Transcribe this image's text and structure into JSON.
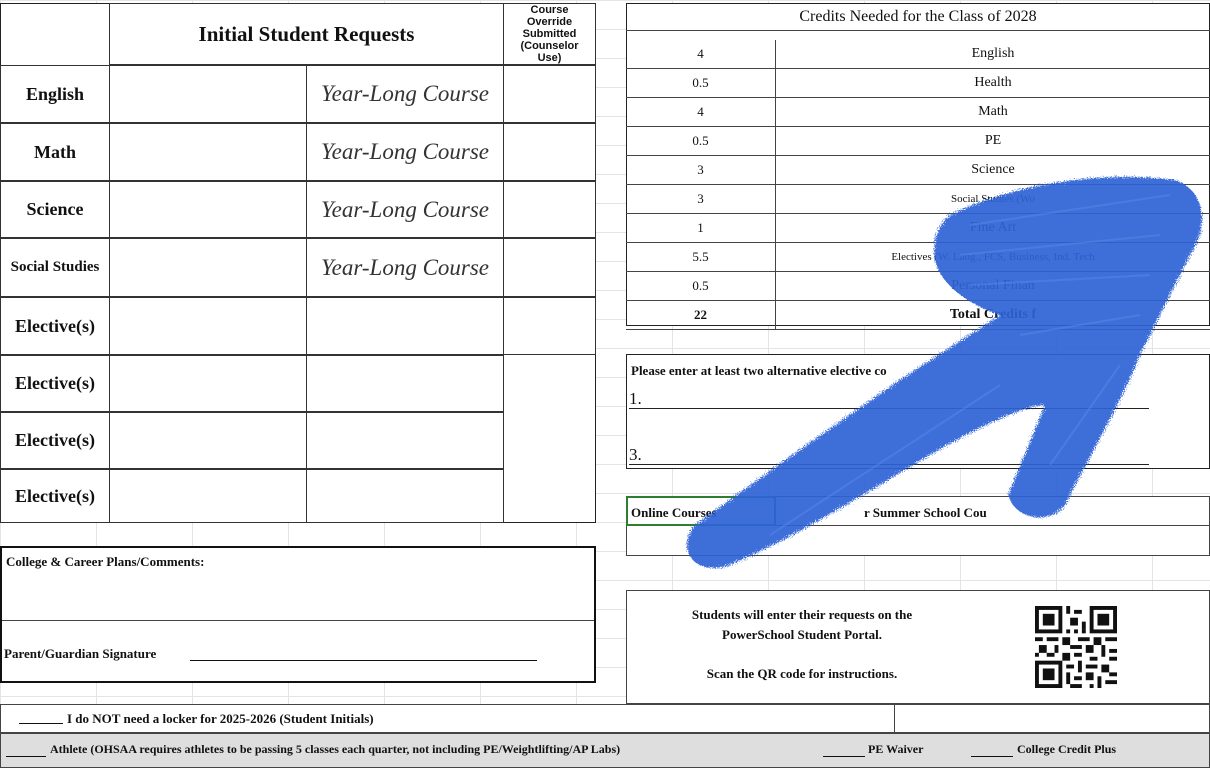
{
  "requests": {
    "title": "Initial Student Requests",
    "override_header": "Course Override Submitted (Counselor Use)",
    "rows": [
      {
        "subject": "English",
        "note": "Year-Long Course"
      },
      {
        "subject": "Math",
        "note": "Year-Long Course"
      },
      {
        "subject": "Science",
        "note": "Year-Long Course"
      },
      {
        "subject": "Social Studies",
        "note": "Year-Long Course"
      },
      {
        "subject": "Elective(s)",
        "note": ""
      },
      {
        "subject": "Elective(s)",
        "note": ""
      },
      {
        "subject": "Elective(s)",
        "note": ""
      },
      {
        "subject": "Elective(s)",
        "note": ""
      }
    ]
  },
  "credits": {
    "title": "Credits Needed for the Class of 2028",
    "rows": [
      {
        "credits": "4",
        "subject": "English"
      },
      {
        "credits": "0.5",
        "subject": "Health"
      },
      {
        "credits": "4",
        "subject": "Math"
      },
      {
        "credits": "0.5",
        "subject": "PE"
      },
      {
        "credits": "3",
        "subject": "Science"
      },
      {
        "credits": "3",
        "subject": "Social Studies (Wo"
      },
      {
        "credits": "1",
        "subject": "Fine Art"
      },
      {
        "credits": "5.5",
        "subject": "Electives (W. Lang., FCS, Business, Ind. Tech"
      },
      {
        "credits": "0.5",
        "subject": "Personal Finan"
      },
      {
        "credits": "22",
        "subject": "Total Credits f"
      }
    ]
  },
  "alternatives": {
    "prompt": "Please enter at least two alternative elective co",
    "line1": "1.",
    "line3": "3."
  },
  "online": {
    "text_left": "Online Courses",
    "text_right": "r Summer School Cou"
  },
  "portal": {
    "line1": "Students will enter their requests on the",
    "line2": "PowerSchool Student Portal.",
    "line3": "Scan the QR code for instructions."
  },
  "plans": {
    "label": "College & Career Plans/Comments:",
    "signature_label": "Parent/Guardian Signature"
  },
  "locker": {
    "text": "I do NOT need a locker for 2025-2026 (Student Initials)"
  },
  "footer": {
    "athlete": "Athlete (OHSAA requires athletes to be passing 5 classes each quarter, not including PE/Weightlifting/AP Labs)",
    "pe_waiver": "PE Waiver",
    "ccp": "College Credit Plus"
  },
  "colors": {
    "scribble": "#2f63d6",
    "footer_bg": "#dedede",
    "online_border": "#2e7d32"
  }
}
